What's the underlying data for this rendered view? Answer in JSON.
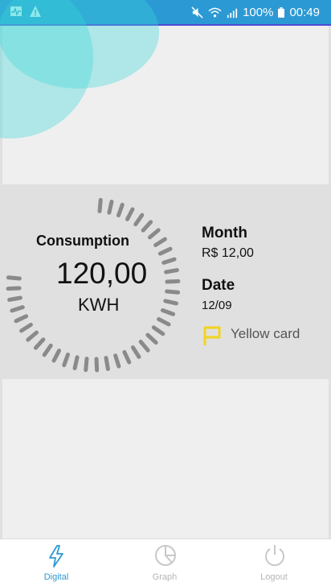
{
  "status_bar": {
    "battery": "100%",
    "time": "00:49",
    "left_icons": [
      "activity-icon",
      "warning-icon"
    ],
    "right_icons": [
      "mute-icon",
      "wifi-icon",
      "signal-icon",
      "battery-icon"
    ]
  },
  "gauge": {
    "label": "Consumption",
    "value": "120,00",
    "unit": "KWH",
    "fill_fraction": 0.78
  },
  "details": {
    "month_label": "Month",
    "month_value": "R$ 12,00",
    "date_label": "Date",
    "date_value": "12/09",
    "flag_text": "Yellow card",
    "flag_color": "#f2d41c"
  },
  "nav": {
    "items": [
      {
        "label": "Digital",
        "icon": "lightning-icon",
        "active": true
      },
      {
        "label": "Graph",
        "icon": "pie-chart-icon",
        "active": false
      },
      {
        "label": "Logout",
        "icon": "power-icon",
        "active": false
      }
    ]
  },
  "colors": {
    "accent": "#2b99d3",
    "bubble": "#39d6d9",
    "gauge_ticks": "#8a8a8a"
  }
}
